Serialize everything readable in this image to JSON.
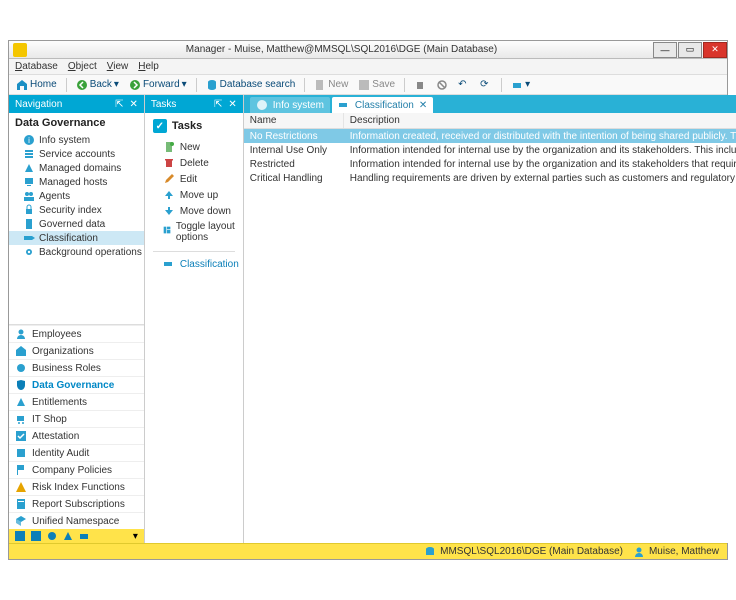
{
  "window": {
    "title": "Manager - Muise, Matthew@MMSQL\\SQL2016\\DGE (Main Database)"
  },
  "menu": {
    "database": "Database",
    "object": "Object",
    "view": "View",
    "help": "Help"
  },
  "toolbar": {
    "home": "Home",
    "back": "Back",
    "forward": "Forward",
    "dbsearch": "Database search",
    "new": "New",
    "save": "Save"
  },
  "nav": {
    "header": "Navigation",
    "title": "Data Governance",
    "tree": [
      {
        "label": "Info system",
        "icon": "info"
      },
      {
        "label": "Service accounts",
        "icon": "stack"
      },
      {
        "label": "Managed domains",
        "icon": "triangle"
      },
      {
        "label": "Managed hosts",
        "icon": "monitor"
      },
      {
        "label": "Agents",
        "icon": "people"
      },
      {
        "label": "Security index",
        "icon": "lock"
      },
      {
        "label": "Governed data",
        "icon": "doc"
      },
      {
        "label": "Classification",
        "icon": "tag",
        "selected": true
      },
      {
        "label": "Background operations",
        "icon": "gear"
      }
    ],
    "sections": [
      {
        "label": "Employees",
        "icon": "person"
      },
      {
        "label": "Organizations",
        "icon": "home"
      },
      {
        "label": "Business Roles",
        "icon": "role"
      },
      {
        "label": "Data Governance",
        "icon": "shield",
        "active": true
      },
      {
        "label": "Entitlements",
        "icon": "triangle"
      },
      {
        "label": "IT Shop",
        "icon": "cart"
      },
      {
        "label": "Attestation",
        "icon": "check"
      },
      {
        "label": "Identity Audit",
        "icon": "audit"
      },
      {
        "label": "Company Policies",
        "icon": "flag"
      },
      {
        "label": "Risk Index Functions",
        "icon": "risk"
      },
      {
        "label": "Report Subscriptions",
        "icon": "report"
      },
      {
        "label": "Unified Namespace",
        "icon": "cube"
      }
    ]
  },
  "tasks": {
    "header": "Tasks",
    "title": "Tasks",
    "items": [
      {
        "label": "New",
        "icon": "new"
      },
      {
        "label": "Delete",
        "icon": "delete"
      },
      {
        "label": "Edit",
        "icon": "edit"
      },
      {
        "label": "Move up",
        "icon": "up"
      },
      {
        "label": "Move down",
        "icon": "down"
      },
      {
        "label": "Toggle layout options",
        "icon": "layout"
      }
    ],
    "link": "Classification"
  },
  "tabs": {
    "t1": "Info system",
    "t2": "Classification"
  },
  "grid": {
    "cols": {
      "name": "Name",
      "desc": "Description"
    },
    "rows": [
      {
        "name": "No Restrictions",
        "desc": "Information created, received or distributed with the intention of being shared publicly. This in…",
        "selected": true
      },
      {
        "name": "Internal Use Only",
        "desc": "Information intended for internal use by the organization and its stakeholders. This includes dist…"
      },
      {
        "name": "Restricted",
        "desc": "Information intended for internal use by the organization and its stakeholders that requires a h…"
      },
      {
        "name": "Critical Handling",
        "desc": "Handling requirements are driven by external parties such as customers and regulatory organiz…"
      }
    ]
  },
  "status": {
    "db": "MMSQL\\SQL2016\\DGE (Main Database)",
    "user": "Muise, Matthew"
  }
}
